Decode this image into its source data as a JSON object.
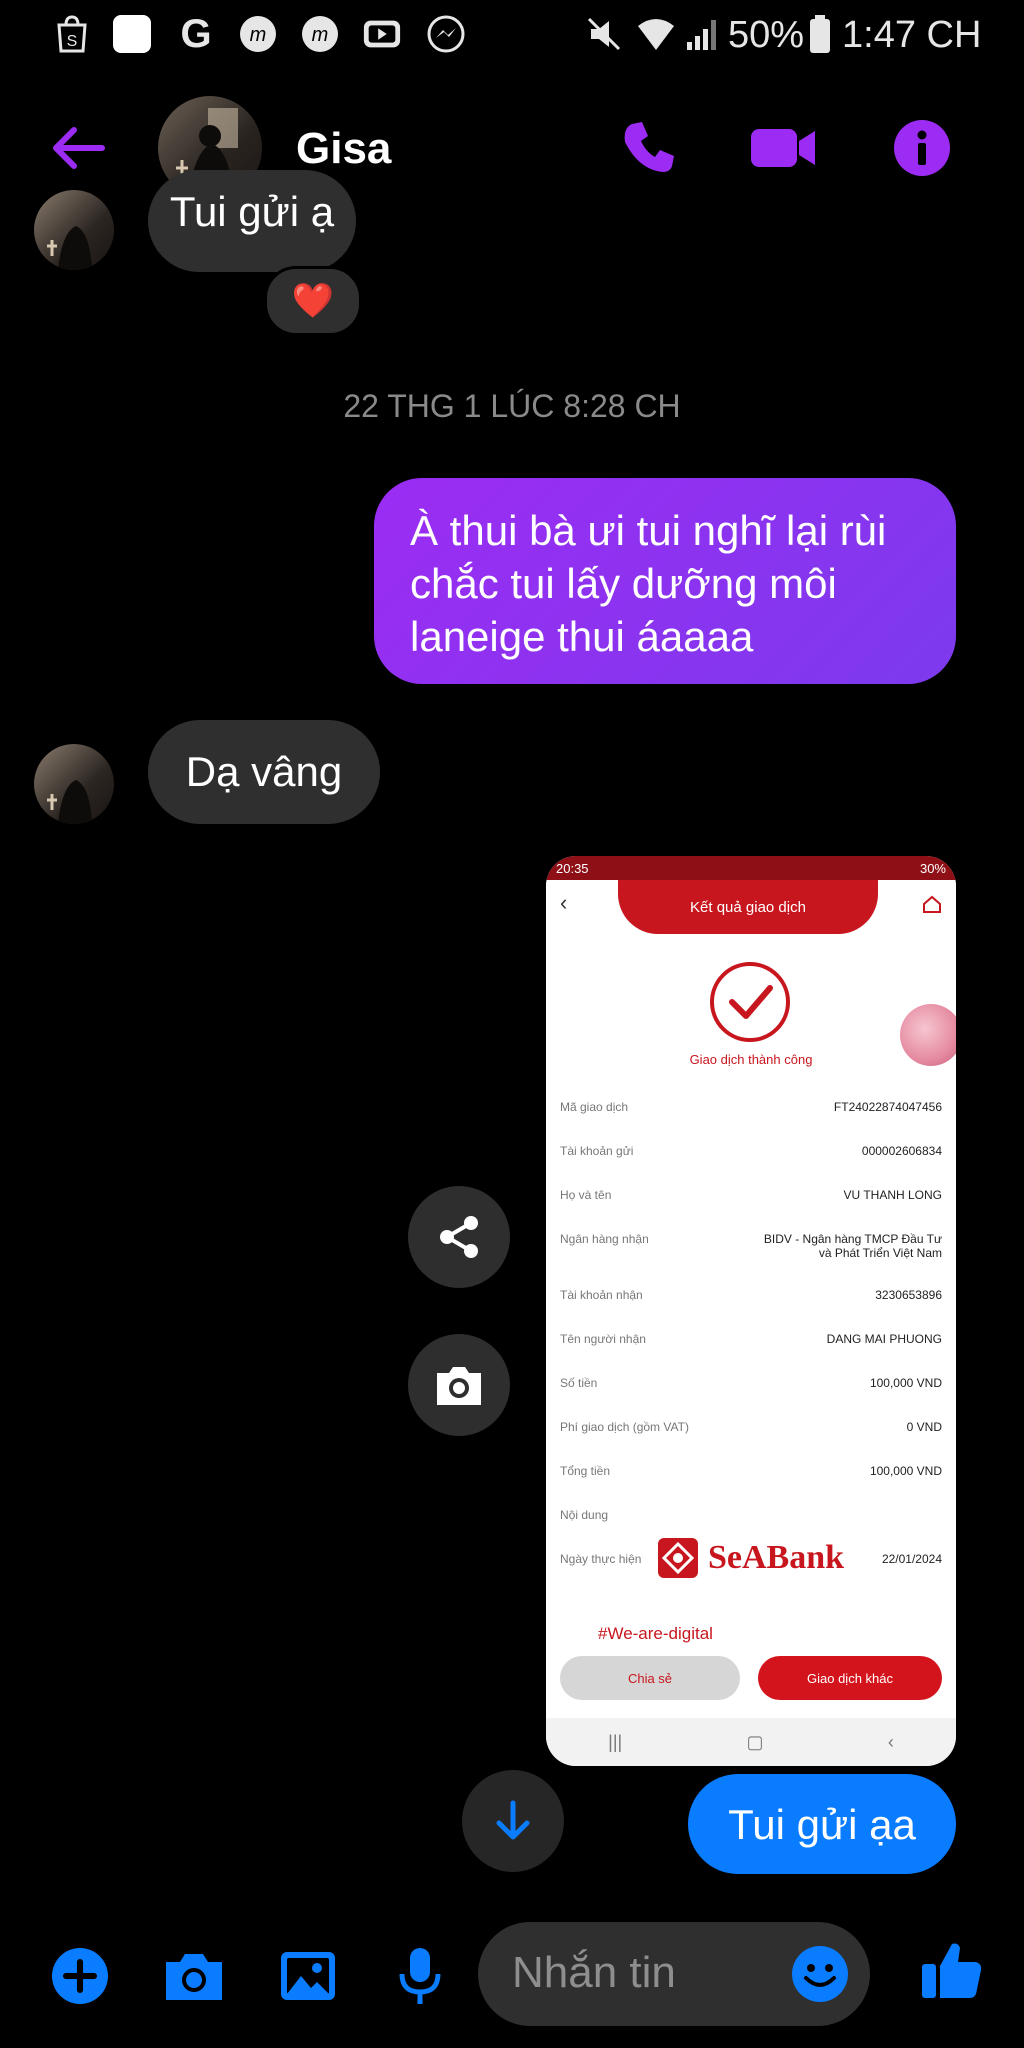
{
  "status_bar": {
    "battery": "50%",
    "time": "1:47 CH",
    "icons": [
      "shopee-icon",
      "white-square-icon",
      "google-icon",
      "messenger-lite-icon",
      "messenger-lite-icon",
      "youtube-icon",
      "messenger-icon",
      "mute-icon",
      "wifi-icon",
      "signal-icon",
      "battery-icon"
    ]
  },
  "header": {
    "contact_name": "Gisa",
    "back_icon": "back-arrow-icon",
    "call_icon": "phone-icon",
    "video_icon": "video-camera-icon",
    "info_icon": "info-icon"
  },
  "conversation": {
    "partial_message": "Tui gửi ạ",
    "reaction": "❤️",
    "timestamp": "22 THG 1 LÚC 8:28 CH",
    "sent_message": "À thui bà ưi tui nghĩ lại rùi chắc tui lấy dưỡng môi laneige thui áaaaa",
    "received_message": "Dạ vâng",
    "last_sent_message": "Tui gửi ạa"
  },
  "receipt": {
    "phone_time": "20:35",
    "phone_battery": "30%",
    "title": "Kết quả giao dịch",
    "status": "Giao dịch thành công",
    "rows": [
      {
        "label": "Mã giao dịch",
        "value": "FT24022874047456"
      },
      {
        "label": "Tài khoản gửi",
        "value": "000002606834"
      },
      {
        "label": "Họ và tên",
        "value": "VU THANH LONG"
      },
      {
        "label": "Ngân hàng nhận",
        "value": "BIDV - Ngân hàng TMCP Đầu Tư và Phát Triển Việt Nam"
      },
      {
        "label": "Tài khoản nhận",
        "value": "3230653896"
      },
      {
        "label": "Tên người nhận",
        "value": "DANG MAI PHUONG"
      },
      {
        "label": "Số tiền",
        "value": "100,000 VND"
      },
      {
        "label": "Phí giao dịch (gồm VAT)",
        "value": "0 VND"
      },
      {
        "label": "Tổng tiền",
        "value": "100,000 VND"
      },
      {
        "label": "Nội dung",
        "value": ""
      },
      {
        "label": "Ngày thực hiện",
        "value": "22/01/2024"
      }
    ],
    "brand": "SeABank",
    "hashtag": "#We-are-digital",
    "share_button": "Chia sẻ",
    "other_button": "Giao dịch khác",
    "nav": [
      "|||",
      "▢",
      "‹"
    ]
  },
  "composer": {
    "placeholder": "Nhắn tin"
  },
  "colors": {
    "accent_purple": "#9c2cf3",
    "accent_blue": "#0a7cff",
    "bubble_grey": "#2f2f2f",
    "seabank_red": "#c8161e"
  }
}
